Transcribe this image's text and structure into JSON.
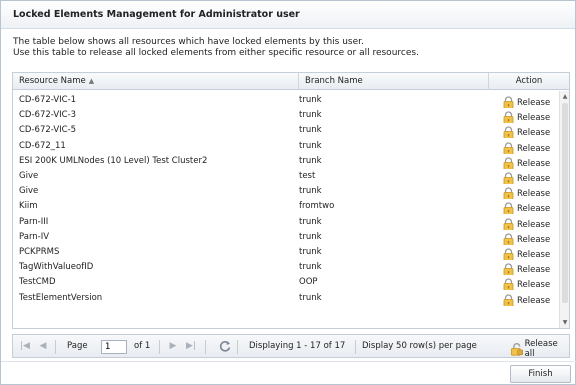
{
  "dialog": {
    "title": "Locked Elements Management for Administrator user",
    "description_line1": "The table below shows all resources which have locked elements by this user.",
    "description_line2": "Use this table to release all locked elements from either specific resource or all resources."
  },
  "table": {
    "columns": [
      "Resource Name",
      "Branch Name",
      "Action"
    ],
    "sort_indicator": "▲",
    "rows": [
      {
        "resource": "CD-672-VIC-1",
        "branch": "trunk",
        "action": "Release"
      },
      {
        "resource": "CD-672-VIC-3",
        "branch": "trunk",
        "action": "Release"
      },
      {
        "resource": "CD-672-VIC-5",
        "branch": "trunk",
        "action": "Release"
      },
      {
        "resource": "CD-672_11",
        "branch": "trunk",
        "action": "Release"
      },
      {
        "resource": "ESI 200K UMLNodes (10 Level) Test Cluster2",
        "branch": "trunk",
        "action": "Release"
      },
      {
        "resource": "Give",
        "branch": "test",
        "action": "Release"
      },
      {
        "resource": "Give",
        "branch": "trunk",
        "action": "Release"
      },
      {
        "resource": "Kiim",
        "branch": "fromtwo",
        "action": "Release"
      },
      {
        "resource": "Parn-III",
        "branch": "trunk",
        "action": "Release"
      },
      {
        "resource": "Parn-IV",
        "branch": "trunk",
        "action": "Release"
      },
      {
        "resource": "PCKPRMS",
        "branch": "trunk",
        "action": "Release"
      },
      {
        "resource": "TagWithValueofID",
        "branch": "trunk",
        "action": "Release"
      },
      {
        "resource": "TestCMD",
        "branch": "OOP",
        "action": "Release"
      },
      {
        "resource": "TestElementVersion",
        "branch": "trunk",
        "action": "Release"
      }
    ]
  },
  "pager": {
    "page_label": "Page",
    "page_value": "1",
    "of_label": "of 1",
    "displaying": "Displaying 1 - 17 of 17",
    "per_page": "Display 50 row(s) per page",
    "release_all": "Release all"
  },
  "footer": {
    "finish": "Finish"
  }
}
